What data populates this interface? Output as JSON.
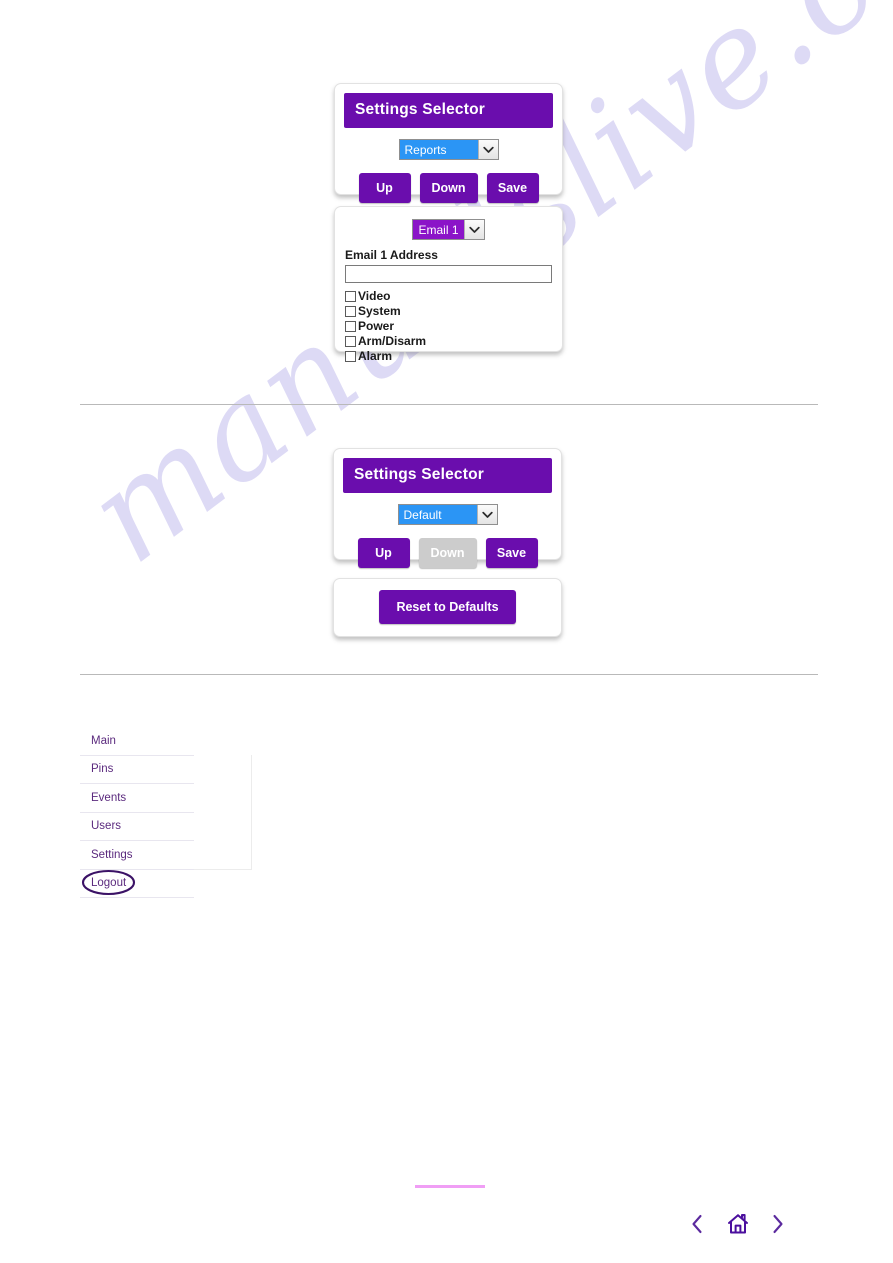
{
  "page": {
    "watermark_text": "manualslive.com",
    "accent_purple": "#6a0dad",
    "select_blue": "#2b95f5",
    "select_purple": "#8b14c8",
    "footer_rule_color": "#f09ef5"
  },
  "settings_selector_top": {
    "title": "Settings Selector",
    "dropdown_value": "Reports",
    "buttons": {
      "up": "Up",
      "down": "Down",
      "save": "Save"
    }
  },
  "email_panel": {
    "dropdown_value": "Email 1",
    "address_label": "Email 1 Address",
    "address_value": "",
    "address_placeholder": "",
    "checkboxes": [
      {
        "label": "Video",
        "checked": false
      },
      {
        "label": "System",
        "checked": false
      },
      {
        "label": "Power",
        "checked": false
      },
      {
        "label": "Arm/Disarm",
        "checked": false
      },
      {
        "label": "Alarm",
        "checked": false
      }
    ]
  },
  "settings_selector_bottom": {
    "title": "Settings Selector",
    "dropdown_value": "Default",
    "buttons": {
      "up": "Up",
      "down": "Down",
      "save": "Save"
    },
    "down_disabled": true
  },
  "reset_panel": {
    "button_label": "Reset to Defaults"
  },
  "nav_menu": {
    "items": [
      {
        "label": "Main"
      },
      {
        "label": "Pins"
      },
      {
        "label": "Events"
      },
      {
        "label": "Users"
      },
      {
        "label": "Settings"
      },
      {
        "label": "Logout"
      }
    ],
    "annotated_item": "Logout"
  },
  "footer_nav": {
    "prev_icon": "chevron-left-icon",
    "home_icon": "home-icon",
    "next_icon": "chevron-right-icon"
  }
}
